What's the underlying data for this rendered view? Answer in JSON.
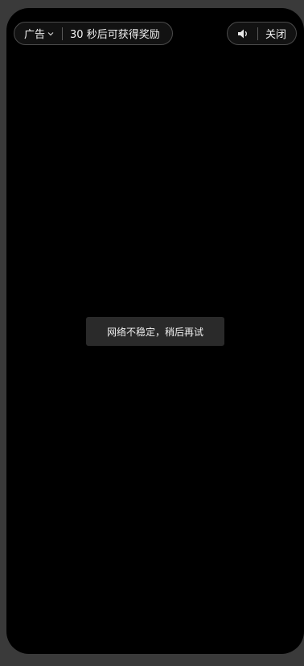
{
  "ad_bar": {
    "ad_label": "广告",
    "reward_countdown": "30 秒后可获得奖励"
  },
  "controls": {
    "sound_icon": "speaker-icon",
    "close_label": "关闭"
  },
  "toast": {
    "message": "网络不稳定，稍后再试"
  },
  "colors": {
    "background": "#000000",
    "pill_border": "#4a4a4a",
    "toast_bg": "#2a2a2a"
  }
}
